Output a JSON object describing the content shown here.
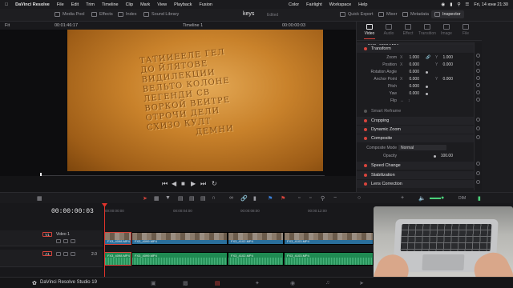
{
  "menubar": {
    "app_name": "DaVinci Resolve",
    "items": [
      "File",
      "Edit",
      "Trim",
      "Timeline",
      "Clip",
      "Mark",
      "View",
      "Playback",
      "Fusion"
    ],
    "right_items": [
      "Color",
      "Fairlight",
      "Workspace",
      "Help"
    ],
    "clock": "Fri, 14 юни  21:30"
  },
  "toolbar": {
    "media_pool": "Media Pool",
    "effects": "Effects",
    "index": "Index",
    "sound_library": "Sound Library",
    "project_title": "keys",
    "project_status": "Edited",
    "quick_export": "Quick Export",
    "mixer": "Mixer",
    "metadata": "Metadata",
    "inspector": "Inspector"
  },
  "viewer": {
    "fit": "Fit",
    "source_timecode": "00:01:46:17",
    "timeline_name": "Timeline 1",
    "record_timecode": "00:00:00:03",
    "engraving_lines": [
      "ТАТИИЕЕЛЕ ГЕЛ",
      "ДО ЙЛЯТОВЕ",
      "ВИДИЛЕКЦИИ",
      "ВЕЛЬТО КОЛОНЕ",
      "ЛЕГЕНДИ СВ",
      "ВОРКОЙ ВЕИТРЕ",
      "ОТРОЧИ ДЕЛИ",
      "СХИЗО КУЛТ",
      "ДЕМНИ"
    ]
  },
  "inspector": {
    "tabs": [
      "Video",
      "Audio",
      "Effect",
      "Transition",
      "Image",
      "File"
    ],
    "active_tab": "Video",
    "clip_name": "FX3_4098.MP4",
    "sections": {
      "transform": "Transform",
      "smart_reframe": "Smart Reframe",
      "cropping": "Cropping",
      "dynamic_zoom": "Dynamic Zoom",
      "composite": "Composite",
      "speed_change": "Speed Change",
      "stabilization": "Stabilization",
      "lens_correction": "Lens Correction"
    },
    "transform": {
      "zoom_label": "Zoom",
      "zoom_x": "1.000",
      "zoom_y": "1.000",
      "position_label": "Position",
      "position_x": "0.000",
      "position_y": "0.000",
      "rotation_label": "Rotation Angle",
      "rotation": "0.000",
      "anchor_label": "Anchor Point",
      "anchor_x": "0.000",
      "anchor_y": "0.000",
      "pitch_label": "Pitch",
      "pitch": "0.000",
      "yaw_label": "Yaw",
      "yaw": "0.000",
      "flip_label": "Flip"
    },
    "composite": {
      "mode_label": "Composite Mode",
      "mode": "Normal",
      "opacity_label": "Opacity",
      "opacity": "100.00"
    }
  },
  "timeline": {
    "timecode": "00:00:00:03",
    "ruler": [
      "00:00:00:00",
      "00:00:04:00",
      "00:00:08:00",
      "00:00:12:00"
    ],
    "video_track": {
      "id": "V1",
      "name": "Video 1"
    },
    "audio_track": {
      "id": "A1",
      "level": "2.0"
    },
    "clips": [
      "FX3_4098.MP4",
      "FX3_4099.MP4",
      "FX3_4102.MP4",
      "FX3_4103.MP4"
    ],
    "audio_clips": [
      "FX3_4098.MP4",
      "FX3_4099.MP4",
      "FX3_4102.MP4",
      "FX3_4103.MP4"
    ],
    "dim_label": "DIM"
  },
  "bottombar": {
    "brand": "DaVinci Resolve Studio 19"
  },
  "colors": {
    "accent": "#d8443c",
    "video_clip": "#2a6f9c",
    "audio_clip": "#1f8a52"
  }
}
